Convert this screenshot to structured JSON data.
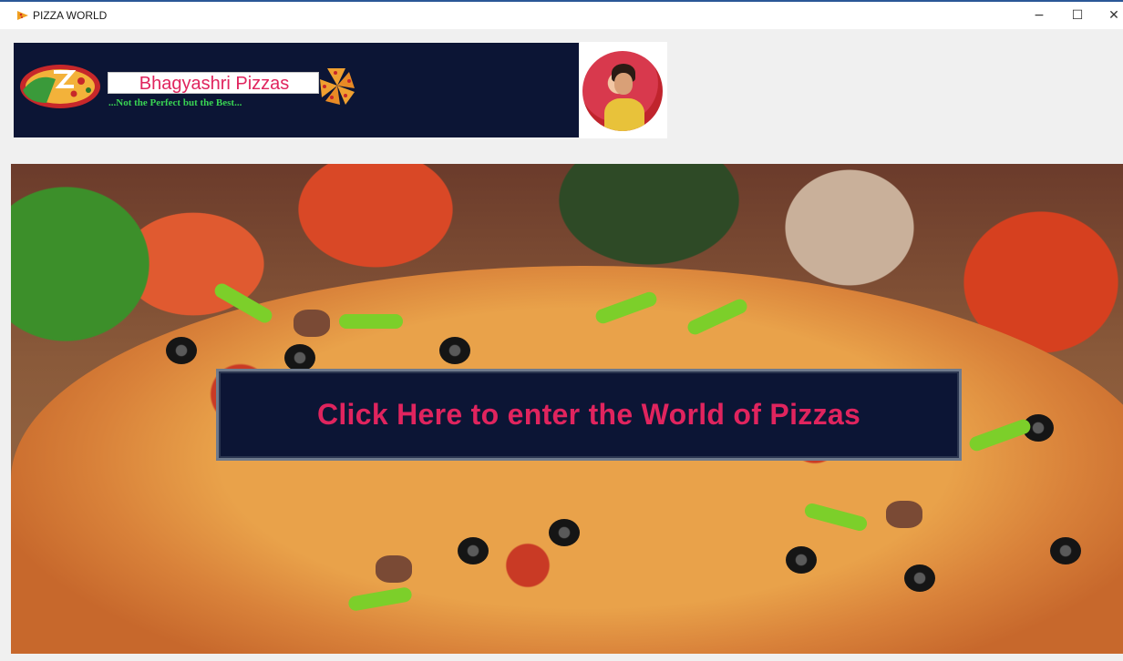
{
  "window": {
    "title": "PIZZA WORLD",
    "controls": {
      "minimize": "−",
      "maximize": "☐",
      "close": "✕"
    }
  },
  "header": {
    "brand_name": "Bhagyashri Pizzas",
    "tagline": "...Not the Perfect but the Best...",
    "logo_icon": "pizza-logo-icon",
    "slice_icon": "pizza-slices-icon",
    "avatar": "profile-avatar"
  },
  "hero": {
    "background": "pizza-photo",
    "enter_button_label": "Click Here to enter the World of Pizzas"
  },
  "colors": {
    "banner_bg": "#0c1535",
    "brand_text": "#e0245e",
    "tagline_text": "#39d353",
    "button_bg": "#0c1535",
    "button_text": "#e0245e"
  }
}
